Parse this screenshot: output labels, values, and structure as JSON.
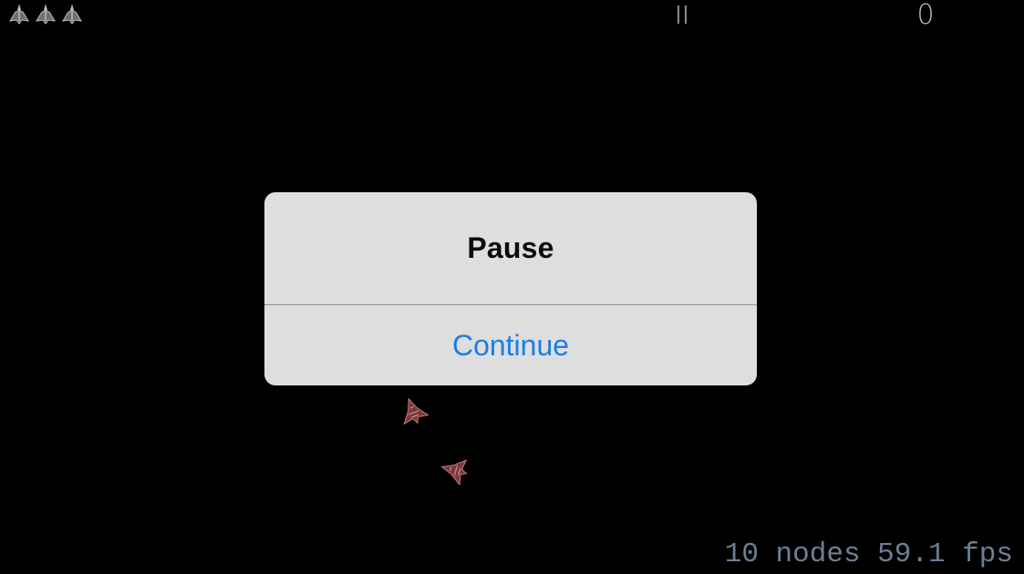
{
  "hud": {
    "lives_count": 3,
    "score": "0",
    "pause_icon": "pause-icon"
  },
  "dialog": {
    "title": "Pause",
    "continue_label": "Continue",
    "button_color": "#1a7ee6"
  },
  "debug": {
    "nodes": "10 nodes",
    "fps": "59.1 fps"
  },
  "colors": {
    "background": "#000000",
    "enemy_ship": "#a85a5a",
    "life_ship": "#9a9a9a"
  }
}
